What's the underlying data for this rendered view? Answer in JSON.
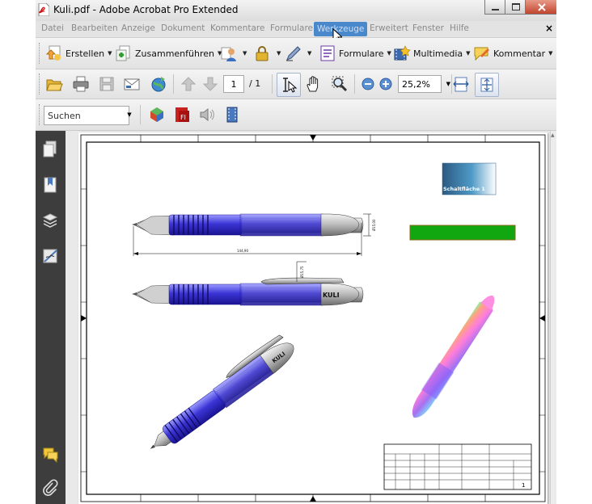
{
  "window": {
    "title": "Kuli.pdf - Adobe Acrobat Pro Extended"
  },
  "menubar": {
    "items": [
      "Datei",
      "Bearbeiten",
      "Anzeige",
      "Dokument",
      "Kommentare",
      "Formulare",
      "Werkzeuge",
      "Erweitert",
      "Fenster",
      "Hilfe"
    ],
    "active": "Werkzeuge",
    "close": "×"
  },
  "toolbar_tasks": {
    "create": "Erstellen",
    "combine": "Zusammenführen",
    "forms": "Formulare",
    "multimedia": "Multimedia",
    "comment": "Kommentar"
  },
  "toolbar_nav": {
    "page_current": "1",
    "page_total": "/ 1",
    "zoom": "25,2%"
  },
  "toolbar_search": {
    "placeholder": "Suchen"
  },
  "drawing": {
    "button_label": "Schaltfläche 1",
    "brand_label": "KULI",
    "dim_length": "144,90",
    "dim_diameter": "Ø15,00",
    "dim_clip": "Ø15,75",
    "titleblock_sheet": "1"
  },
  "colors": {
    "accent_blue": "#4a88cc",
    "pen_blue": "#3b34d6",
    "field_green": "#11a711",
    "panel_dark": "#3d3d3d"
  },
  "icons": {
    "left_panel": [
      "pages-icon",
      "bookmarks-icon",
      "layers-icon",
      "signatures-icon",
      "comments-icon",
      "attachments-icon"
    ]
  }
}
